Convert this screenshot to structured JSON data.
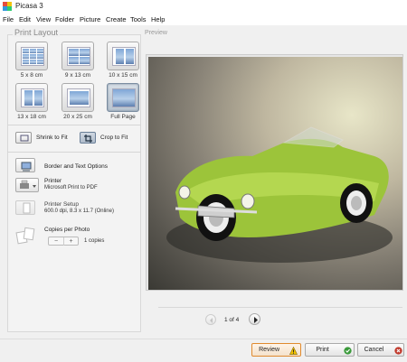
{
  "app": {
    "title": "Picasa 3"
  },
  "menu": [
    "File",
    "Edit",
    "View",
    "Folder",
    "Picture",
    "Create",
    "Tools",
    "Help"
  ],
  "print_layout": {
    "section_title": "Print Layout",
    "sizes": [
      {
        "label": "5 x 8 cm",
        "selected": false
      },
      {
        "label": "9 x 13 cm",
        "selected": false
      },
      {
        "label": "10 x 15 cm",
        "selected": false
      },
      {
        "label": "13 x 18 cm",
        "selected": false
      },
      {
        "label": "20 x 25 cm",
        "selected": false
      },
      {
        "label": "Full Page",
        "selected": true
      }
    ],
    "shrink_to_fit": "Shrink to Fit",
    "crop_to_fit": "Crop to Fit",
    "fit_mode": "crop",
    "border_text_options": "Border and Text Options",
    "printer_label": "Printer",
    "printer_name": "Microsoft Print to PDF",
    "printer_setup_label": "Printer Setup",
    "printer_setup_detail": "600.0 dpi, 8.3 x 11.7 (Online)",
    "copies_label": "Copies per Photo",
    "copies_minus": "−",
    "copies_plus": "+",
    "copies_value": "1 copies"
  },
  "preview": {
    "section_title": "Preview",
    "page_indicator": "1 of 4"
  },
  "actions": {
    "review": "Review",
    "print": "Print",
    "cancel": "Cancel"
  },
  "colors": {
    "accent_orange": "#e08a2e",
    "print_green": "#3a9a3a",
    "cancel_red": "#c0392b",
    "warning_yellow": "#f2c200",
    "car_green": "#a8cf3a"
  }
}
